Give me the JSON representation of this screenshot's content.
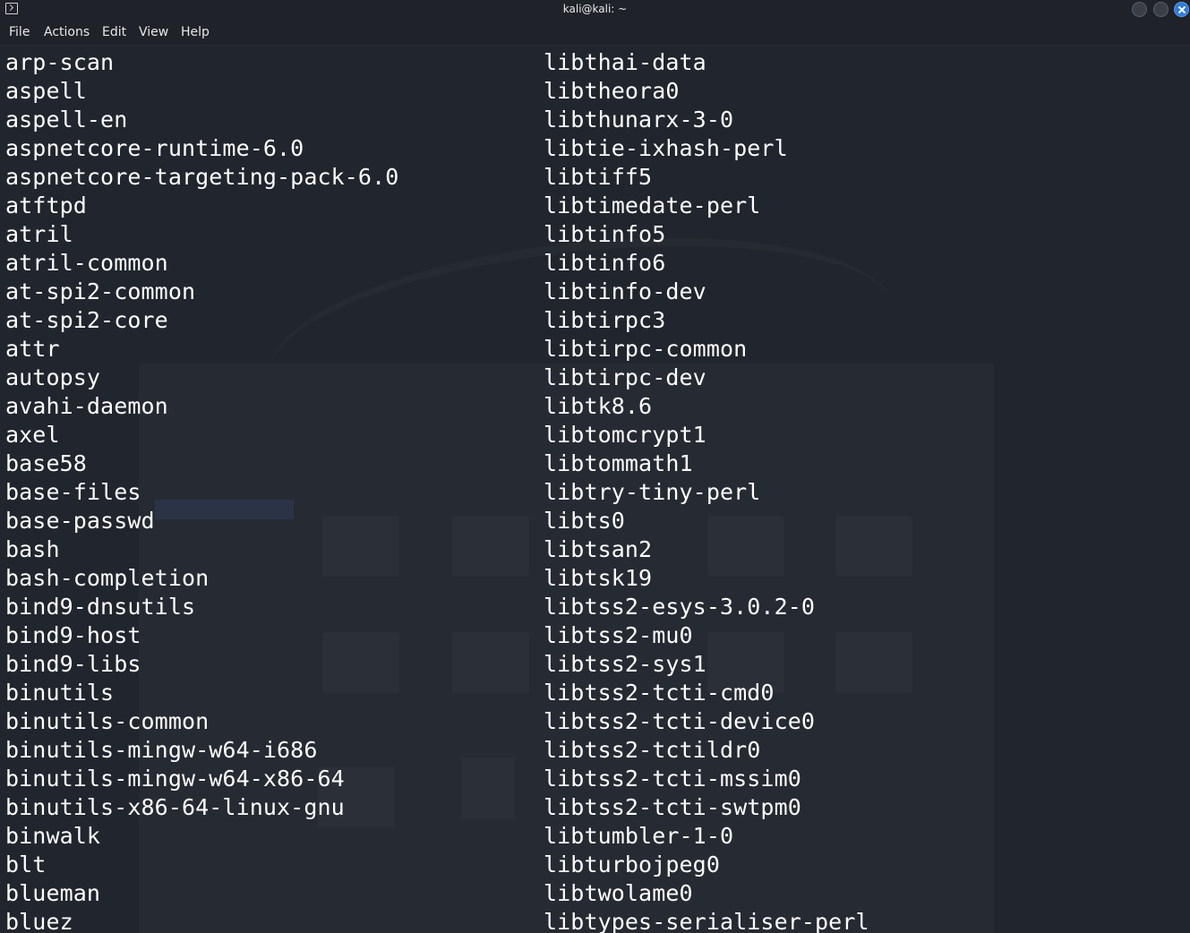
{
  "window": {
    "title": "kali@kali: ~"
  },
  "menu": {
    "items": [
      "File",
      "Actions",
      "Edit",
      "View",
      "Help"
    ]
  },
  "terminal": {
    "left_column": [
      "arp-scan",
      "aspell",
      "aspell-en",
      "aspnetcore-runtime-6.0",
      "aspnetcore-targeting-pack-6.0",
      "atftpd",
      "atril",
      "atril-common",
      "at-spi2-common",
      "at-spi2-core",
      "attr",
      "autopsy",
      "avahi-daemon",
      "axel",
      "base58",
      "base-files",
      "base-passwd",
      "bash",
      "bash-completion",
      "bind9-dnsutils",
      "bind9-host",
      "bind9-libs",
      "binutils",
      "binutils-common",
      "binutils-mingw-w64-i686",
      "binutils-mingw-w64-x86-64",
      "binutils-x86-64-linux-gnu",
      "binwalk",
      "blt",
      "blueman",
      "bluez"
    ],
    "right_column": [
      "libthai-data",
      "libtheora0",
      "libthunarx-3-0",
      "libtie-ixhash-perl",
      "libtiff5",
      "libtimedate-perl",
      "libtinfo5",
      "libtinfo6",
      "libtinfo-dev",
      "libtirpc3",
      "libtirpc-common",
      "libtirpc-dev",
      "libtk8.6",
      "libtomcrypt1",
      "libtommath1",
      "libtry-tiny-perl",
      "libts0",
      "libtsan2",
      "libtsk19",
      "libtss2-esys-3.0.2-0",
      "libtss2-mu0",
      "libtss2-sys1",
      "libtss2-tcti-cmd0",
      "libtss2-tcti-device0",
      "libtss2-tctildr0",
      "libtss2-tcti-mssim0",
      "libtss2-tcti-swtpm0",
      "libtumbler-1-0",
      "libturbojpeg0",
      "libtwolame0",
      "libtypes-serialiser-perl"
    ]
  },
  "colors": {
    "background": "#21252d",
    "text": "#ffffff",
    "close_button": "#2f7ad9"
  }
}
